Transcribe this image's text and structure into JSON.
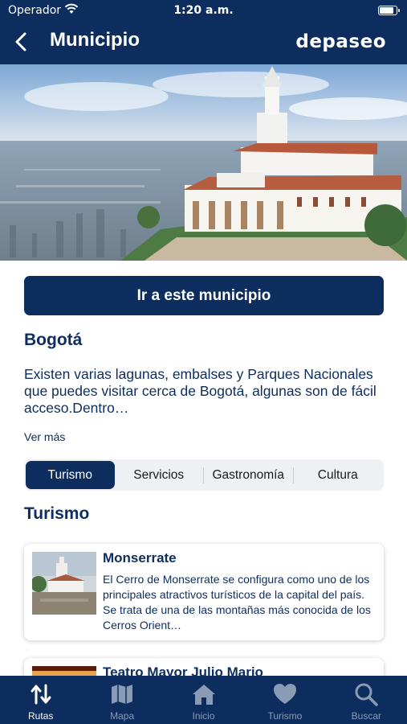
{
  "status_bar": {
    "carrier": "Operador",
    "time": "1:20 a.m."
  },
  "header": {
    "title": "Municipio",
    "brand": "depaseo"
  },
  "cta_label": "Ir a este municipio",
  "municipality": {
    "name": "Bogotá",
    "description": "Existen varias lagunas, embalses y Parques Nacionales que puedes visitar cerca de Bogotá, algunas son de fácil acceso.Dentro…",
    "more_label": "Ver más"
  },
  "segments": [
    {
      "label": "Turismo",
      "active": true
    },
    {
      "label": "Servicios",
      "active": false
    },
    {
      "label": "Gastronomía",
      "active": false
    },
    {
      "label": "Cultura",
      "active": false
    }
  ],
  "section_title": "Turismo",
  "places": [
    {
      "title": "Monserrate",
      "description": "El Cerro de Monserrate se configura como uno de los principales atractivos turísticos de la capital del país. Se trata de una de las montañas más conocida de los Cerros Orient…"
    },
    {
      "title": "Teatro Mayor Julio Mario",
      "description": ""
    }
  ],
  "tabs": [
    {
      "label": "Rutas",
      "icon": "routes-icon",
      "active": true
    },
    {
      "label": "Mapa",
      "icon": "map-icon",
      "active": false
    },
    {
      "label": "Inicio",
      "icon": "home-icon",
      "active": false
    },
    {
      "label": "Turismo",
      "icon": "heart-icon",
      "active": false
    },
    {
      "label": "Buscar",
      "icon": "search-icon",
      "active": false
    }
  ],
  "colors": {
    "primary": "#0d2d5e",
    "segment_bg": "#eef0f3",
    "tab_inactive": "#8a9bb6"
  }
}
